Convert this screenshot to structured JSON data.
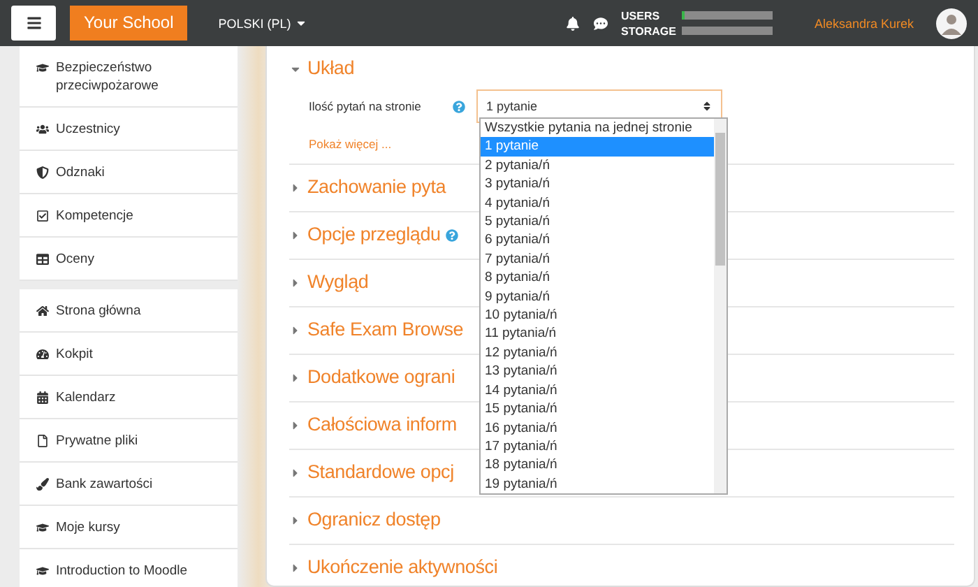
{
  "navbar": {
    "brand": "Your School",
    "language": "POLSKI (PL)",
    "quota": [
      {
        "label": "USERS",
        "level": 0.03
      },
      {
        "label": "STORAGE",
        "level": 0
      }
    ],
    "user": "Aleksandra Kurek"
  },
  "sidebar": {
    "groups": [
      {
        "items": [
          "Bezpieczeństwo przeciwpożarowe",
          "Uczestnicy",
          "Odznaki",
          "Kompetencje",
          "Oceny"
        ]
      },
      {
        "items": [
          "Strona główna",
          "Kokpit",
          "Kalendarz",
          "Prywatne pliki",
          "Bank zawartości",
          "Moje kursy",
          "Introduction to Moodle"
        ]
      }
    ]
  },
  "sections": [
    {
      "title": "Układ",
      "expanded": true,
      "field": {
        "label": "Ilość pytań na stronie",
        "value": "1 pytanie"
      },
      "more": "Pokaż więcej ..."
    },
    {
      "title": "Zachowanie pyta",
      "expanded": false
    },
    {
      "title": "Opcje przeglądu",
      "expanded": false,
      "help": true
    },
    {
      "title": "Wygląd",
      "expanded": false
    },
    {
      "title": "Safe Exam Browse",
      "expanded": false
    },
    {
      "title": "Dodatkowe ograni",
      "expanded": false
    },
    {
      "title": "Całościowa inform",
      "expanded": false
    },
    {
      "title": "Standardowe opcj",
      "expanded": false
    },
    {
      "title": "Ogranicz dostęp",
      "expanded": false
    },
    {
      "title": "Ukończenie aktywności",
      "expanded": false
    }
  ],
  "dropdown": {
    "options": [
      {
        "label": "Wszystkie pytania na jednej stronie",
        "selected": false
      },
      {
        "label": "1 pytanie",
        "selected": true
      },
      {
        "label": "2 pytania/ń",
        "selected": false
      },
      {
        "label": "3 pytania/ń",
        "selected": false
      },
      {
        "label": "4 pytania/ń",
        "selected": false
      },
      {
        "label": "5 pytania/ń",
        "selected": false
      },
      {
        "label": "6 pytania/ń",
        "selected": false
      },
      {
        "label": "7 pytania/ń",
        "selected": false
      },
      {
        "label": "8 pytania/ń",
        "selected": false
      },
      {
        "label": "9 pytania/ń",
        "selected": false
      },
      {
        "label": "10 pytania/ń",
        "selected": false
      },
      {
        "label": "11 pytania/ń",
        "selected": false
      },
      {
        "label": "12 pytania/ń",
        "selected": false
      },
      {
        "label": "13 pytania/ń",
        "selected": false
      },
      {
        "label": "14 pytania/ń",
        "selected": false
      },
      {
        "label": "15 pytania/ń",
        "selected": false
      },
      {
        "label": "16 pytania/ń",
        "selected": false
      },
      {
        "label": "17 pytania/ń",
        "selected": false
      },
      {
        "label": "18 pytania/ń",
        "selected": false
      },
      {
        "label": "19 pytania/ń",
        "selected": false
      }
    ]
  }
}
